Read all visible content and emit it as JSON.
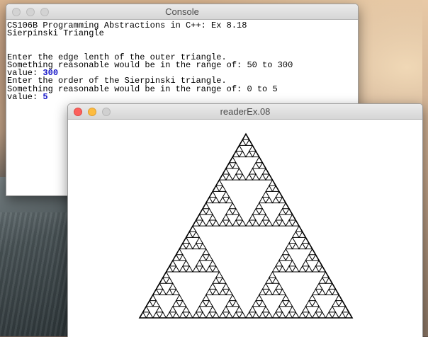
{
  "console": {
    "title": "Console",
    "lines": {
      "l0": "CS106B Programming Abstractions in C++: Ex 8.18",
      "l1": "Sierpinski Triangle",
      "l2": "",
      "l3": "",
      "l4": "Enter the edge lenth of the outer triangle.",
      "l5": "Something reasonable would be in the range of: 50 to 300",
      "l6_prefix": "value: ",
      "l6_value": "300",
      "l7": "Enter the order of the Sierpinski triangle.",
      "l8": "Something reasonable would be in the range of: 0 to 5",
      "l9_prefix": "value: ",
      "l9_value": "5"
    },
    "value_color": "#1515c8"
  },
  "graphics_window": {
    "title": "readerEx.08",
    "triangle": {
      "order": 5,
      "edge_length": 300,
      "stroke_color": "#000000"
    }
  },
  "icons": [
    "close-icon",
    "minimize-icon",
    "zoom-icon"
  ]
}
